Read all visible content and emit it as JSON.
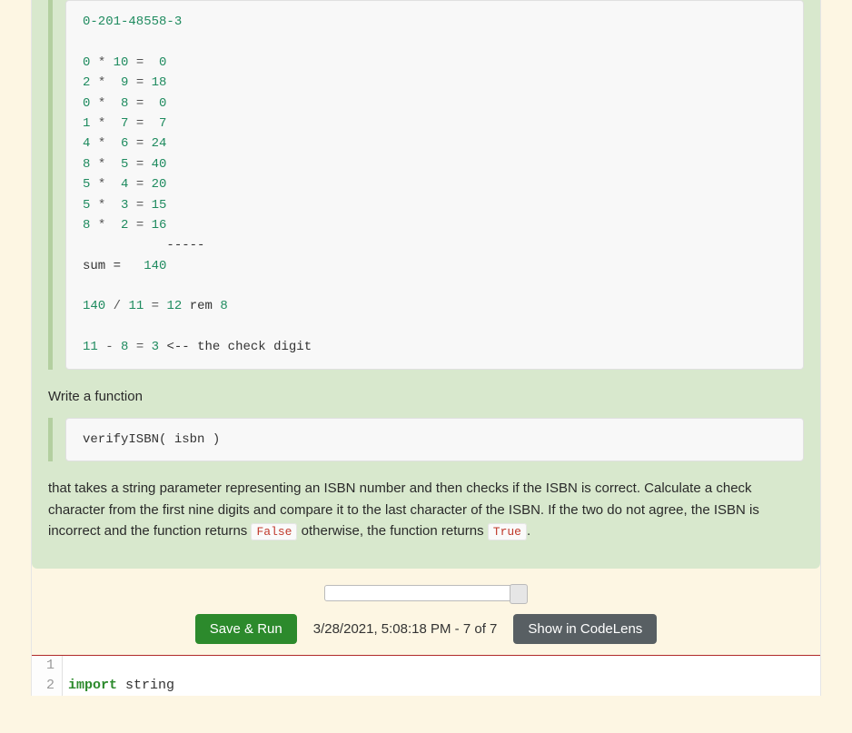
{
  "example": {
    "isbn": "0-201-48558-3",
    "rows": [
      {
        "d": "0",
        "w": "10",
        "p": "0"
      },
      {
        "d": "2",
        "w": "9",
        "p": "18"
      },
      {
        "d": "0",
        "w": "8",
        "p": "0"
      },
      {
        "d": "1",
        "w": "7",
        "p": "7"
      },
      {
        "d": "4",
        "w": "6",
        "p": "24"
      },
      {
        "d": "8",
        "w": "5",
        "p": "40"
      },
      {
        "d": "5",
        "w": "4",
        "p": "20"
      },
      {
        "d": "5",
        "w": "3",
        "p": "15"
      },
      {
        "d": "8",
        "w": "2",
        "p": "16"
      }
    ],
    "dashes": "           -----",
    "sum_label": "sum =   ",
    "sum": "140",
    "div_a": "140",
    "div_b": "11",
    "div_q": "12",
    "div_rem_label": "rem",
    "div_r": "8",
    "sub_a": "11",
    "sub_b": "8",
    "sub_res": "3",
    "sub_tail": " <-- the check digit"
  },
  "text": {
    "write_fn": "Write a function",
    "signature": "verifyISBN( isbn )",
    "para1": "that takes a string parameter representing an ISBN number and then checks if the ISBN is correct. Calculate a check character from the first nine digits and compare it to the last character of the ISBN. If the two do not agree, the ISBN is incorrect and the function returns ",
    "false": "False",
    "mid": " otherwise, the function returns ",
    "true": "True",
    "dot": "."
  },
  "controls": {
    "save_run": "Save & Run",
    "status": "3/28/2021, 5:08:18 PM - 7 of 7",
    "codelens": "Show in CodeLens"
  },
  "editor": {
    "lines": [
      {
        "n": "1",
        "kw": "",
        "rest": ""
      },
      {
        "n": "2",
        "kw": "import",
        "rest": " string"
      }
    ]
  }
}
